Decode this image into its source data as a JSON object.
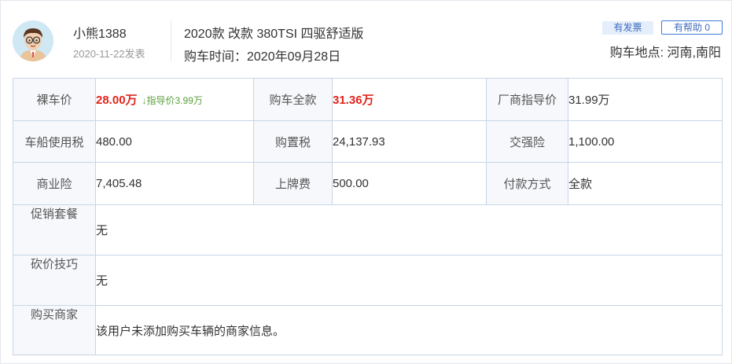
{
  "user": {
    "name": "小熊1388",
    "post_date": "2020-11-22发表"
  },
  "car": {
    "model": "2020款 改款 380TSI 四驱舒适版",
    "buy_time": "购车时间：2020年09月28日"
  },
  "badges": {
    "invoice": "有发票",
    "helpful": "有帮助 0"
  },
  "location": "购车地点: 河南,南阳",
  "table": {
    "row1": {
      "bare_price_label": "裸车价",
      "bare_price_value": "28.00万",
      "guide_note": "↓指导价3.99万",
      "total_price_label": "购车全款",
      "total_price_value": "31.36万",
      "msrp_label": "厂商指导价",
      "msrp_value": "31.99万"
    },
    "row2": {
      "vehicle_tax_label": "车船使用税",
      "vehicle_tax_value": "480.00",
      "purchase_tax_label": "购置税",
      "purchase_tax_value": "24,137.93",
      "compulsory_ins_label": "交强险",
      "compulsory_ins_value": "1,100.00"
    },
    "row3": {
      "commercial_ins_label": "商业险",
      "commercial_ins_value": "7,405.48",
      "plate_fee_label": "上牌费",
      "plate_fee_value": "500.00",
      "payment_label": "付款方式",
      "payment_value": "全款"
    },
    "promo_label": "促销套餐",
    "promo_value": "无",
    "bargain_label": "砍价技巧",
    "bargain_value": "无",
    "dealer_label": "购买商家",
    "dealer_value": "该用户未添加购买车辆的商家信息。"
  },
  "colors": {
    "price_red": "#e2231a",
    "guide_green": "#5a9e3c",
    "accent_blue": "#3d6bbd",
    "border": "#c7d6e8"
  }
}
